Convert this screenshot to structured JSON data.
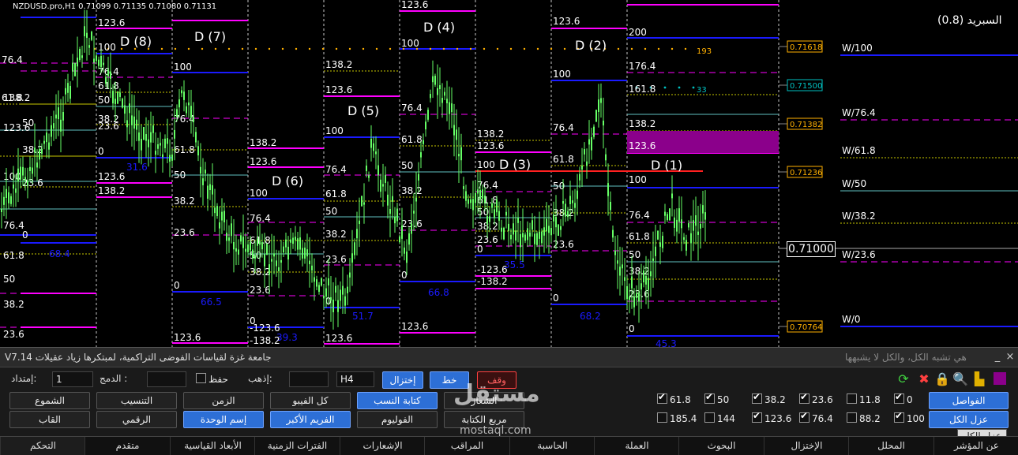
{
  "chart": {
    "symbol_header": "NZDUSD.pro,H1  0.71099 0.71135 0.71080 0.71131",
    "spread_text": "السبريد (0.8)",
    "current_price": "0.71000",
    "right_prices": [
      "0.71618",
      "0.71500",
      "0.71382",
      "0.71236",
      "0.70764"
    ],
    "right_price_colors": [
      "#ffb000",
      "#00c0c0",
      "#ffb000",
      "#ffb000",
      "#ffb000"
    ],
    "w_labels": [
      "W/100",
      "W/76.4",
      "W/61.8",
      "W/50",
      "W/38.2",
      "W/23.6",
      "W/0"
    ],
    "d_labels": [
      "D (8)",
      "D (7)",
      "D (6)",
      "D (5)",
      "D (4)",
      "D (3)",
      "D (2)",
      "D (1)"
    ],
    "blue_values": [
      "68.4",
      "31.6",
      "66.5",
      "39.3",
      "51.7",
      "66.8",
      "35.5",
      "68.2",
      "45.3"
    ],
    "dot_values": [
      "193",
      "33"
    ],
    "levels": [
      "76.4",
      "61.8",
      "138.2",
      "123.6",
      "50",
      "38.2",
      "100",
      "23.6",
      "76.4",
      "0",
      "61.8",
      "50",
      "38.2",
      "23.6",
      "123.6",
      "100",
      "76.4",
      "61.8",
      "50",
      "38.2",
      "23.6",
      "0",
      "123.6",
      "138.2",
      "100",
      "76.4",
      "61.8",
      "50",
      "38.2",
      "23.6",
      "0",
      "123.6",
      "138.2",
      "123.6",
      "100",
      "76.4",
      "61.8",
      "50",
      "38.2",
      "23.6",
      "0",
      "-123.6",
      "-138.2",
      "138.2",
      "123.6",
      "100",
      "76.4",
      "61.8",
      "50",
      "38.2",
      "23.6",
      "0",
      "123.6",
      "123.6",
      "100",
      "76.4",
      "61.8",
      "50",
      "38.2",
      "23.6",
      "0",
      "123.6",
      "138.2",
      "123.6",
      "100",
      "76.4",
      "61.8",
      "50",
      "38.2",
      "23.6",
      "0",
      "-123.6",
      "-138.2",
      "123.6",
      "100",
      "76.4",
      "61.8",
      "50",
      "38.2",
      "23.6",
      "0",
      "200",
      "176.4",
      "161.8",
      "138.2",
      "123.6",
      "100",
      "76.4",
      "61.8",
      "50",
      "38.2",
      "23.6",
      "0"
    ]
  },
  "panel": {
    "title": "جامعة غزة لقياسات الفوضى التراكمية، لمبتكرها زياد عقيلات V7.14",
    "tagline": "هي تشبه الكل، والكل لا يشبهها",
    "win_controls": [
      "_",
      "×"
    ],
    "fields": {
      "imtidad_label": "إمتداد:",
      "imtidad_value": "1",
      "damj_label": "الدمج :",
      "hifz_label": "حفظ",
      "idhab_label": "إذهب:",
      "timeframe": "H4"
    },
    "top_buttons": {
      "ikhtizal": "إختزال",
      "khat": "خط",
      "waqf": "وقف"
    },
    "buttons_row1": [
      "الشموع",
      "التنسيب",
      "الزمن",
      "كل الفيبو",
      "كتابة النسب",
      "الشعار"
    ],
    "buttons_row2": [
      "القاب",
      "الرقمي",
      "إسم الوحدة",
      "الفريم الأكبر",
      "الفوليوم",
      "مربع الكتابة"
    ],
    "fib_checks_row1": [
      {
        "label": "61.8",
        "on": true
      },
      {
        "label": "50",
        "on": true
      },
      {
        "label": "38.2",
        "on": true
      },
      {
        "label": "23.6",
        "on": true
      },
      {
        "label": "11.8",
        "on": false
      },
      {
        "label": "0",
        "on": true
      }
    ],
    "fib_checks_row2": [
      {
        "label": "185.4",
        "on": false
      },
      {
        "label": "144",
        "on": false
      },
      {
        "label": "123.6",
        "on": true
      },
      {
        "label": "76.4",
        "on": true
      },
      {
        "label": "88.2",
        "on": false
      },
      {
        "label": "100",
        "on": true
      }
    ],
    "right_buttons": [
      "الفواصل",
      "عزل الكل"
    ],
    "tooltip": "عزل الكل",
    "tabs": [
      "التحكم",
      "متقدم",
      "الأبعاد القياسية",
      "الفترات الزمنية",
      "الإشعارات",
      "المراقب",
      "الحاسبة",
      "العملة",
      "البحوث",
      "الإختزال",
      "المحلل",
      "عن المؤشر"
    ],
    "watermark": "مستقل",
    "watermark_url": "mostaql.com"
  },
  "colors": {
    "blue": "#1a1aff",
    "magenta": "#ff00ff",
    "yellow": "#c8c800",
    "green": "#66ff66",
    "cyan": "#60c0c0",
    "red": "#ff2020",
    "purple": "#8b008b"
  }
}
